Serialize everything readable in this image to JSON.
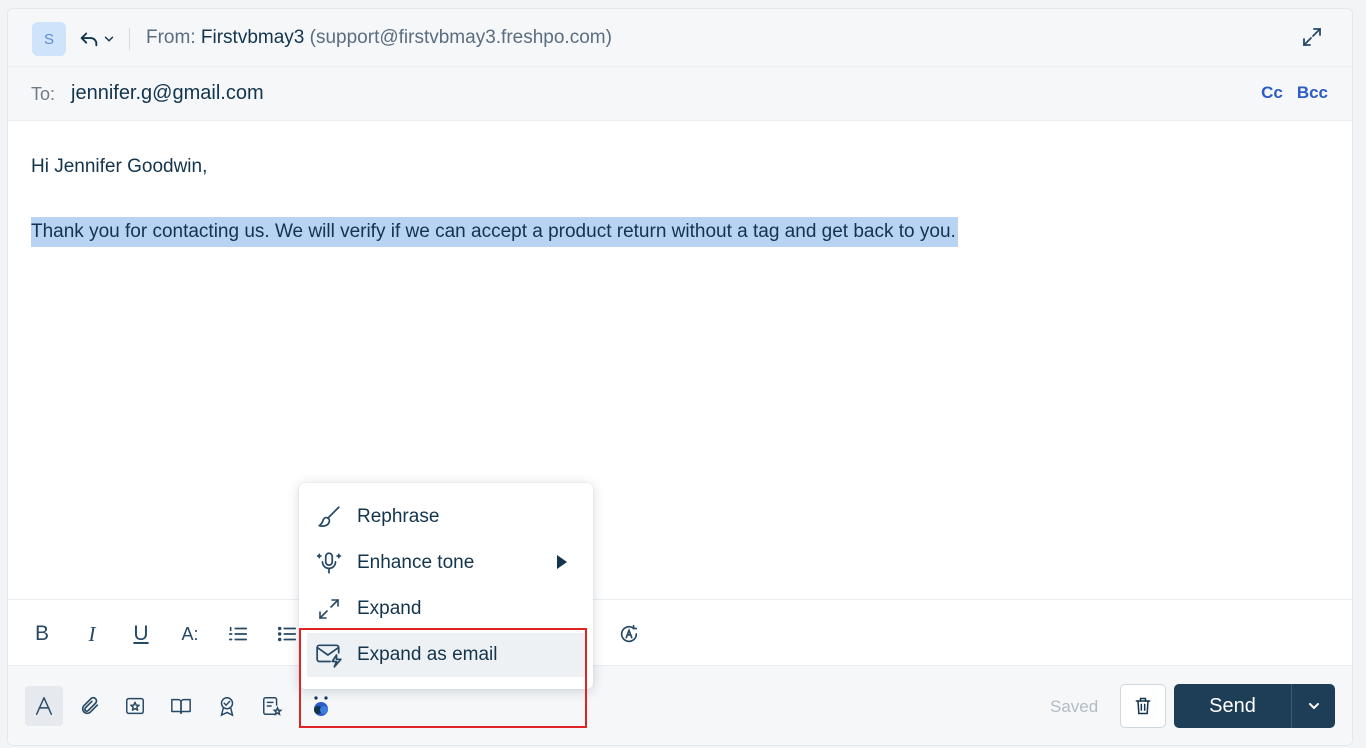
{
  "header": {
    "avatar_initial": "S",
    "from_label": "From:",
    "from_name": "Firstvbmay3",
    "from_email": "(support@firstvbmay3.freshpo.com)"
  },
  "recipients": {
    "to_label": "To:",
    "to_value": "jennifer.g@gmail.com",
    "cc_label": "Cc",
    "bcc_label": "Bcc"
  },
  "body": {
    "greeting": "Hi Jennifer Goodwin,",
    "selected_text": "Thank you for contacting us. We will verify if we can accept a product return without a tag and get back to you."
  },
  "format_toolbar": {
    "bold": "B",
    "italic": "I",
    "underline": "U",
    "font_size": "A:"
  },
  "ai_menu": {
    "items": [
      {
        "label": "Rephrase",
        "icon": "brush-icon"
      },
      {
        "label": "Enhance tone",
        "icon": "microphone-sparkle-icon",
        "has_submenu": true
      },
      {
        "label": "Expand",
        "icon": "expand-arrows-icon"
      },
      {
        "label": "Expand as email",
        "icon": "mail-bolt-icon",
        "hovered": true
      }
    ]
  },
  "footer": {
    "saved_label": "Saved",
    "send_label": "Send"
  },
  "colors": {
    "primary_button": "#1e3e57",
    "link": "#2c5cc5",
    "selection": "#b8d3f4",
    "highlight_box": "#e02424"
  }
}
